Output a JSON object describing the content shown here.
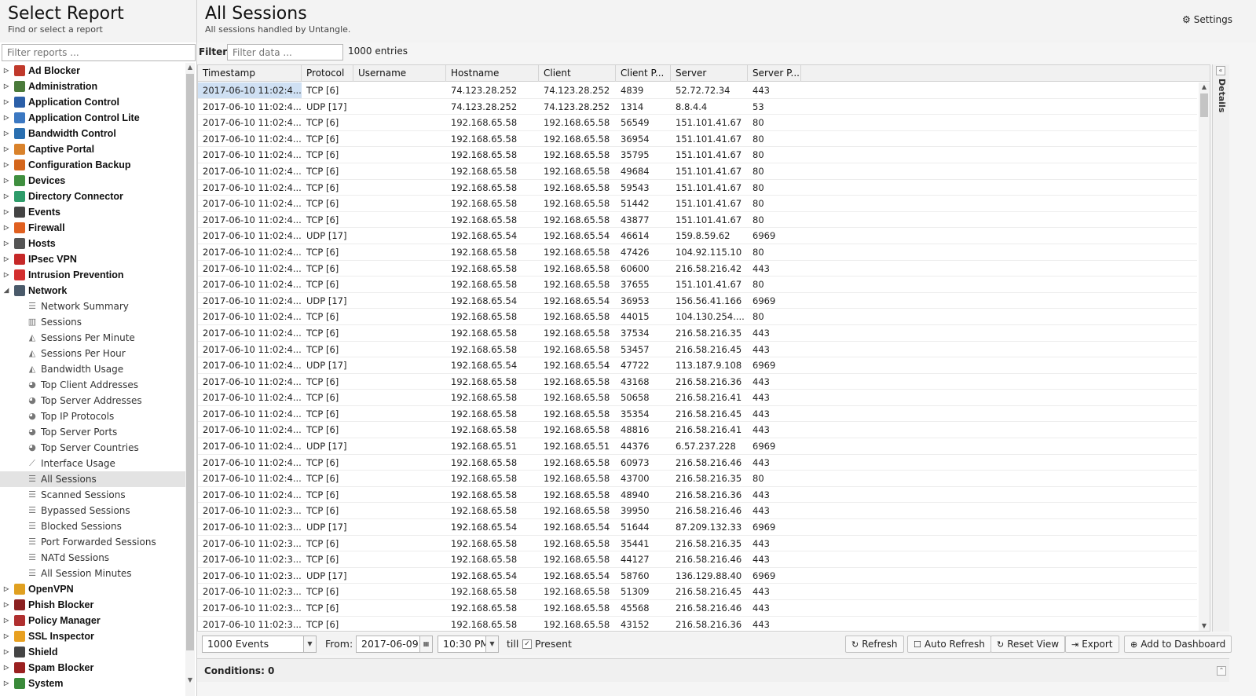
{
  "left": {
    "title": "Select Report",
    "subtitle": "Find or select a report",
    "filter_placeholder": "Filter reports ...",
    "top_items": [
      {
        "label": "Ad Blocker",
        "icon": "ad-blocker-icon",
        "color": "#c0392b"
      },
      {
        "label": "Administration",
        "icon": "administration-icon",
        "color": "#4a7a3a"
      },
      {
        "label": "Application Control",
        "icon": "application-control-icon",
        "color": "#2b5fa8"
      },
      {
        "label": "Application Control Lite",
        "icon": "application-control-lite-icon",
        "color": "#3b78c2"
      },
      {
        "label": "Bandwidth Control",
        "icon": "bandwidth-control-icon",
        "color": "#2a6fb0"
      },
      {
        "label": "Captive Portal",
        "icon": "captive-portal-icon",
        "color": "#d9822b"
      },
      {
        "label": "Configuration Backup",
        "icon": "configuration-backup-icon",
        "color": "#d4661c"
      },
      {
        "label": "Devices",
        "icon": "devices-icon",
        "color": "#3f8f3f"
      },
      {
        "label": "Directory Connector",
        "icon": "directory-connector-icon",
        "color": "#2e9c6a"
      },
      {
        "label": "Events",
        "icon": "events-icon",
        "color": "#444444"
      },
      {
        "label": "Firewall",
        "icon": "firewall-icon",
        "color": "#e06020"
      },
      {
        "label": "Hosts",
        "icon": "hosts-icon",
        "color": "#555555"
      },
      {
        "label": "IPsec VPN",
        "icon": "ipsec-vpn-icon",
        "color": "#c62828"
      },
      {
        "label": "Intrusion Prevention",
        "icon": "intrusion-prevention-icon",
        "color": "#d32f2f"
      },
      {
        "label": "Network",
        "icon": "network-icon",
        "color": "#4a5a6a"
      }
    ],
    "network_children": [
      {
        "label": "Network Summary",
        "icon": "list-icon"
      },
      {
        "label": "Sessions",
        "icon": "bar-chart-icon"
      },
      {
        "label": "Sessions Per Minute",
        "icon": "area-chart-icon"
      },
      {
        "label": "Sessions Per Hour",
        "icon": "area-chart-icon"
      },
      {
        "label": "Bandwidth Usage",
        "icon": "area-chart-icon"
      },
      {
        "label": "Top Client Addresses",
        "icon": "pie-chart-icon"
      },
      {
        "label": "Top Server Addresses",
        "icon": "pie-chart-icon"
      },
      {
        "label": "Top IP Protocols",
        "icon": "pie-chart-icon"
      },
      {
        "label": "Top Server Ports",
        "icon": "pie-chart-icon"
      },
      {
        "label": "Top Server Countries",
        "icon": "pie-chart-icon"
      },
      {
        "label": "Interface Usage",
        "icon": "line-chart-icon"
      },
      {
        "label": "All Sessions",
        "icon": "list-icon",
        "selected": true
      },
      {
        "label": "Scanned Sessions",
        "icon": "list-icon"
      },
      {
        "label": "Bypassed Sessions",
        "icon": "list-icon"
      },
      {
        "label": "Blocked Sessions",
        "icon": "list-icon"
      },
      {
        "label": "Port Forwarded Sessions",
        "icon": "list-icon"
      },
      {
        "label": "NATd Sessions",
        "icon": "list-icon"
      },
      {
        "label": "All Session Minutes",
        "icon": "list-icon"
      }
    ],
    "bottom_items": [
      {
        "label": "OpenVPN",
        "icon": "openvpn-icon",
        "color": "#e0a020"
      },
      {
        "label": "Phish Blocker",
        "icon": "phish-blocker-icon",
        "color": "#8b2020"
      },
      {
        "label": "Policy Manager",
        "icon": "policy-manager-icon",
        "color": "#b03030"
      },
      {
        "label": "SSL Inspector",
        "icon": "ssl-inspector-icon",
        "color": "#e8a020"
      },
      {
        "label": "Shield",
        "icon": "shield-icon",
        "color": "#444444"
      },
      {
        "label": "Spam Blocker",
        "icon": "spam-blocker-icon",
        "color": "#9a2020"
      },
      {
        "label": "System",
        "icon": "system-icon",
        "color": "#3a8a3a"
      }
    ]
  },
  "main": {
    "title": "All Sessions",
    "subtitle": "All sessions handled by Untangle.",
    "settings_label": "Settings",
    "filter_label": "Filter:",
    "filter_placeholder": "Filter data ...",
    "entries_label": "1000 entries",
    "details_label": "Details",
    "columns": [
      "Timestamp",
      "Protocol",
      "Username",
      "Hostname",
      "Client",
      "Client P...",
      "Server",
      "Server P..."
    ],
    "rows": [
      [
        "2017-06-10 11:02:4...",
        "TCP [6]",
        "",
        "74.123.28.252",
        "74.123.28.252",
        "4839",
        "52.72.72.34",
        "443"
      ],
      [
        "2017-06-10 11:02:4...",
        "UDP [17]",
        "",
        "74.123.28.252",
        "74.123.28.252",
        "1314",
        "8.8.4.4",
        "53"
      ],
      [
        "2017-06-10 11:02:4...",
        "TCP [6]",
        "",
        "192.168.65.58",
        "192.168.65.58",
        "56549",
        "151.101.41.67",
        "80"
      ],
      [
        "2017-06-10 11:02:4...",
        "TCP [6]",
        "",
        "192.168.65.58",
        "192.168.65.58",
        "36954",
        "151.101.41.67",
        "80"
      ],
      [
        "2017-06-10 11:02:4...",
        "TCP [6]",
        "",
        "192.168.65.58",
        "192.168.65.58",
        "35795",
        "151.101.41.67",
        "80"
      ],
      [
        "2017-06-10 11:02:4...",
        "TCP [6]",
        "",
        "192.168.65.58",
        "192.168.65.58",
        "49684",
        "151.101.41.67",
        "80"
      ],
      [
        "2017-06-10 11:02:4...",
        "TCP [6]",
        "",
        "192.168.65.58",
        "192.168.65.58",
        "59543",
        "151.101.41.67",
        "80"
      ],
      [
        "2017-06-10 11:02:4...",
        "TCP [6]",
        "",
        "192.168.65.58",
        "192.168.65.58",
        "51442",
        "151.101.41.67",
        "80"
      ],
      [
        "2017-06-10 11:02:4...",
        "TCP [6]",
        "",
        "192.168.65.58",
        "192.168.65.58",
        "43877",
        "151.101.41.67",
        "80"
      ],
      [
        "2017-06-10 11:02:4...",
        "UDP [17]",
        "",
        "192.168.65.54",
        "192.168.65.54",
        "46614",
        "159.8.59.62",
        "6969"
      ],
      [
        "2017-06-10 11:02:4...",
        "TCP [6]",
        "",
        "192.168.65.58",
        "192.168.65.58",
        "47426",
        "104.92.115.10",
        "80"
      ],
      [
        "2017-06-10 11:02:4...",
        "TCP [6]",
        "",
        "192.168.65.58",
        "192.168.65.58",
        "60600",
        "216.58.216.42",
        "443"
      ],
      [
        "2017-06-10 11:02:4...",
        "TCP [6]",
        "",
        "192.168.65.58",
        "192.168.65.58",
        "37655",
        "151.101.41.67",
        "80"
      ],
      [
        "2017-06-10 11:02:4...",
        "UDP [17]",
        "",
        "192.168.65.54",
        "192.168.65.54",
        "36953",
        "156.56.41.166",
        "6969"
      ],
      [
        "2017-06-10 11:02:4...",
        "TCP [6]",
        "",
        "192.168.65.58",
        "192.168.65.58",
        "44015",
        "104.130.254....",
        "80"
      ],
      [
        "2017-06-10 11:02:4...",
        "TCP [6]",
        "",
        "192.168.65.58",
        "192.168.65.58",
        "37534",
        "216.58.216.35",
        "443"
      ],
      [
        "2017-06-10 11:02:4...",
        "TCP [6]",
        "",
        "192.168.65.58",
        "192.168.65.58",
        "53457",
        "216.58.216.45",
        "443"
      ],
      [
        "2017-06-10 11:02:4...",
        "UDP [17]",
        "",
        "192.168.65.54",
        "192.168.65.54",
        "47722",
        "113.187.9.108",
        "6969"
      ],
      [
        "2017-06-10 11:02:4...",
        "TCP [6]",
        "",
        "192.168.65.58",
        "192.168.65.58",
        "43168",
        "216.58.216.36",
        "443"
      ],
      [
        "2017-06-10 11:02:4...",
        "TCP [6]",
        "",
        "192.168.65.58",
        "192.168.65.58",
        "50658",
        "216.58.216.41",
        "443"
      ],
      [
        "2017-06-10 11:02:4...",
        "TCP [6]",
        "",
        "192.168.65.58",
        "192.168.65.58",
        "35354",
        "216.58.216.45",
        "443"
      ],
      [
        "2017-06-10 11:02:4...",
        "TCP [6]",
        "",
        "192.168.65.58",
        "192.168.65.58",
        "48816",
        "216.58.216.41",
        "443"
      ],
      [
        "2017-06-10 11:02:4...",
        "UDP [17]",
        "",
        "192.168.65.51",
        "192.168.65.51",
        "44376",
        "6.57.237.228",
        "6969"
      ],
      [
        "2017-06-10 11:02:4...",
        "TCP [6]",
        "",
        "192.168.65.58",
        "192.168.65.58",
        "60973",
        "216.58.216.46",
        "443"
      ],
      [
        "2017-06-10 11:02:4...",
        "TCP [6]",
        "",
        "192.168.65.58",
        "192.168.65.58",
        "43700",
        "216.58.216.35",
        "80"
      ],
      [
        "2017-06-10 11:02:4...",
        "TCP [6]",
        "",
        "192.168.65.58",
        "192.168.65.58",
        "48940",
        "216.58.216.36",
        "443"
      ],
      [
        "2017-06-10 11:02:3...",
        "TCP [6]",
        "",
        "192.168.65.58",
        "192.168.65.58",
        "39950",
        "216.58.216.46",
        "443"
      ],
      [
        "2017-06-10 11:02:3...",
        "UDP [17]",
        "",
        "192.168.65.54",
        "192.168.65.54",
        "51644",
        "87.209.132.33",
        "6969"
      ],
      [
        "2017-06-10 11:02:3...",
        "TCP [6]",
        "",
        "192.168.65.58",
        "192.168.65.58",
        "35441",
        "216.58.216.35",
        "443"
      ],
      [
        "2017-06-10 11:02:3...",
        "TCP [6]",
        "",
        "192.168.65.58",
        "192.168.65.58",
        "44127",
        "216.58.216.46",
        "443"
      ],
      [
        "2017-06-10 11:02:3...",
        "UDP [17]",
        "",
        "192.168.65.54",
        "192.168.65.54",
        "58760",
        "136.129.88.40",
        "6969"
      ],
      [
        "2017-06-10 11:02:3...",
        "TCP [6]",
        "",
        "192.168.65.58",
        "192.168.65.58",
        "51309",
        "216.58.216.45",
        "443"
      ],
      [
        "2017-06-10 11:02:3...",
        "TCP [6]",
        "",
        "192.168.65.58",
        "192.168.65.58",
        "45568",
        "216.58.216.46",
        "443"
      ],
      [
        "2017-06-10 11:02:3...",
        "TCP [6]",
        "",
        "192.168.65.58",
        "192.168.65.58",
        "43152",
        "216.58.216.36",
        "443"
      ]
    ]
  },
  "toolbar": {
    "events_value": "1000 Events",
    "from_label": "From:",
    "from_date": "2017-06-09",
    "from_time": "10:30 PM",
    "till_label": "till",
    "present_label": "Present",
    "present_checked": true,
    "refresh_label": "Refresh",
    "auto_refresh_label": "Auto Refresh",
    "reset_view_label": "Reset View",
    "export_label": "Export",
    "add_dashboard_label": "Add to Dashboard"
  },
  "conditions": {
    "label": "Conditions: 0"
  },
  "colors": {
    "selection": "#cfe0f3",
    "tree_selected": "#e3e3e3",
    "header_bg": "#f3f3f3"
  }
}
